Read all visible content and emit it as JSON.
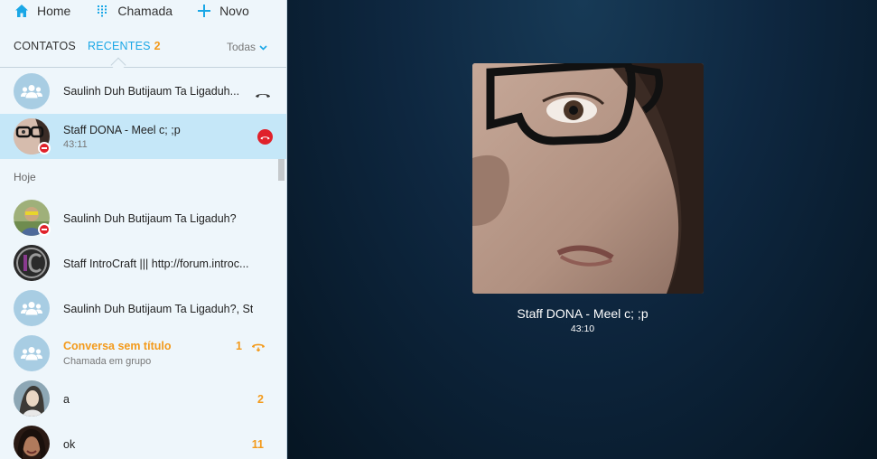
{
  "nav": {
    "home_label": "Home",
    "call_label": "Chamada",
    "new_label": "Novo"
  },
  "tabs": {
    "contacts_label": "CONTATOS",
    "recents_label": "RECENTES",
    "recents_count": "2",
    "filter_label": "Todas"
  },
  "active_calls": [
    {
      "name": "Saulinh Duh Butijaum Ta Ligaduh..."
    },
    {
      "name": "Staff DONA - Meel c; ;p",
      "duration": "43:11"
    }
  ],
  "section_label": "Hoje",
  "recent": [
    {
      "name": "Saulinh Duh Butijaum Ta Ligaduh?"
    },
    {
      "name": "Staff IntroCraft ||| http://forum.introc..."
    },
    {
      "name": "Saulinh Duh Butijaum Ta Ligaduh?, St..."
    },
    {
      "name": "Conversa sem título",
      "subtitle": "Chamada em grupo",
      "badge": "1"
    },
    {
      "name": "a",
      "badge": "2"
    },
    {
      "name": "ok",
      "badge": "11"
    }
  ],
  "call": {
    "name": "Staff DONA - Meel c; ;p",
    "time": "43:10"
  },
  "colors": {
    "accent": "#1aa7e6",
    "unread": "#f39a1b",
    "end_call": "#e0212a",
    "active_row": "#c5e7f8",
    "stage_bg": "#0e2740"
  }
}
